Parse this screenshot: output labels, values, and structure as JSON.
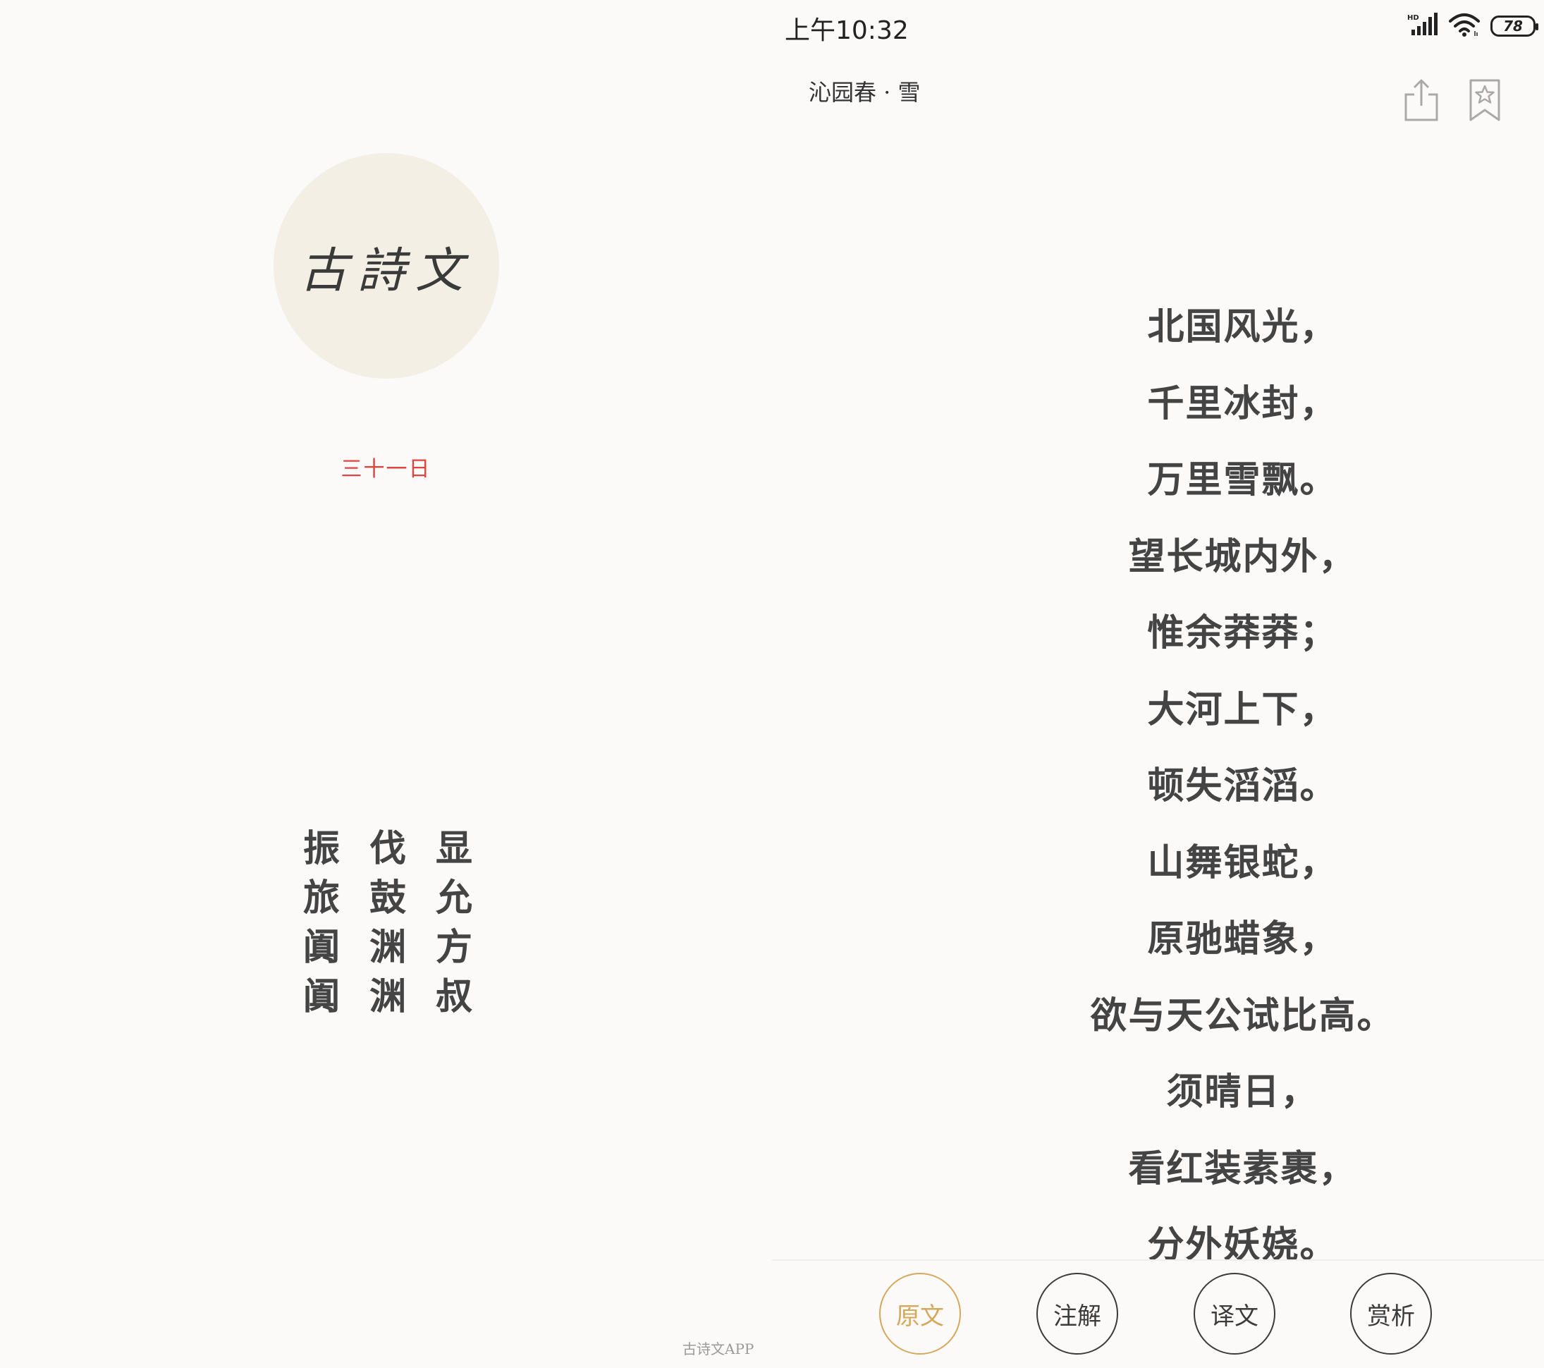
{
  "left": {
    "logo_text": "古詩文",
    "date": "三十一日",
    "poem_rows": [
      [
        "振",
        "伐",
        "显"
      ],
      [
        "旅",
        "鼓",
        "允"
      ],
      [
        "阗",
        "渊",
        "方"
      ],
      [
        "阗",
        "渊",
        "叔"
      ]
    ],
    "credit": "古诗文APP"
  },
  "status": {
    "time": "上午10:32",
    "battery": "78",
    "signal_icon": "signal-icon",
    "wifi_icon": "wifi-icon"
  },
  "header": {
    "title": "沁园春 · 雪",
    "share_icon": "share-icon",
    "bookmark_icon": "bookmark-star-icon"
  },
  "poem": {
    "lines": [
      "北国风光，",
      "千里冰封，",
      "万里雪飘。",
      "望长城内外，",
      "惟余莽莽；",
      "大河上下，",
      "顿失滔滔。",
      "山舞银蛇，",
      "原驰蜡象，",
      "欲与天公试比高。",
      "须晴日，",
      "看红装素裹，",
      "分外妖娆。"
    ]
  },
  "tabs": {
    "items": [
      {
        "label": "原文",
        "active": true
      },
      {
        "label": "注解",
        "active": false
      },
      {
        "label": "译文",
        "active": false
      },
      {
        "label": "赏析",
        "active": false
      }
    ]
  },
  "colors": {
    "background": "#fbfaf9",
    "accent": "#d5a95b",
    "date_red": "#e0443e",
    "logo_circle": "#f4efe5"
  }
}
